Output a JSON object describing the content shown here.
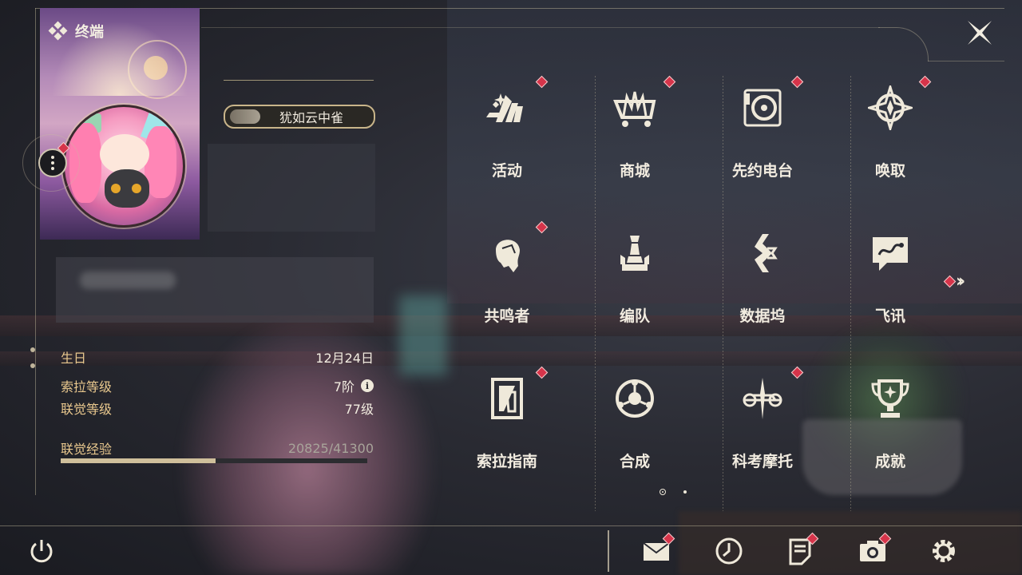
{
  "window": {
    "title": "终端"
  },
  "profile": {
    "name": "犹如云中雀",
    "stats": [
      {
        "label": "生日",
        "value": "12月24日",
        "info": false
      },
      {
        "label": "索拉等级",
        "value": "7阶",
        "info": true
      },
      {
        "label": "联觉等级",
        "value": "77级",
        "info": false
      }
    ],
    "xp": {
      "label": "联觉经验",
      "value": "20825/41300",
      "current": 20825,
      "max": 41300
    }
  },
  "menu": {
    "items": [
      {
        "label": "活动",
        "icon": "sparkle-slash-icon",
        "badge": true
      },
      {
        "label": "商城",
        "icon": "crown-cart-icon",
        "badge": true
      },
      {
        "label": "先约电台",
        "icon": "radio-disc-icon",
        "badge": true
      },
      {
        "label": "唤取",
        "icon": "compass-star-icon",
        "badge": true
      },
      {
        "label": "共鸣者",
        "icon": "character-head-icon",
        "badge": true
      },
      {
        "label": "编队",
        "icon": "chess-team-icon",
        "badge": false
      },
      {
        "label": "数据坞",
        "icon": "data-dock-icon",
        "badge": false
      },
      {
        "label": "飞讯",
        "icon": "message-bubble-icon",
        "badge": false
      },
      {
        "label": "索拉指南",
        "icon": "guide-book-icon",
        "badge": true
      },
      {
        "label": "合成",
        "icon": "synthesis-orb-icon",
        "badge": false
      },
      {
        "label": "科考摩托",
        "icon": "motorcycle-icon",
        "badge": true
      },
      {
        "label": "成就",
        "icon": "trophy-icon",
        "badge": false
      }
    ],
    "page": {
      "current": 1,
      "total": 2
    },
    "next_badge": true
  },
  "bottom_bar": {
    "left": [
      {
        "icon": "power-icon"
      }
    ],
    "right": [
      {
        "icon": "mail-icon",
        "badge": true
      },
      {
        "icon": "clock-history-icon",
        "badge": false
      },
      {
        "icon": "notice-icon",
        "badge": true
      },
      {
        "icon": "camera-icon",
        "badge": true
      },
      {
        "icon": "settings-gear-icon",
        "badge": false
      }
    ]
  },
  "colors": {
    "accent": "#e9c88e",
    "badge": "#d6344a",
    "text": "#f2ece0",
    "xp_fill": "#cfbf9b"
  }
}
